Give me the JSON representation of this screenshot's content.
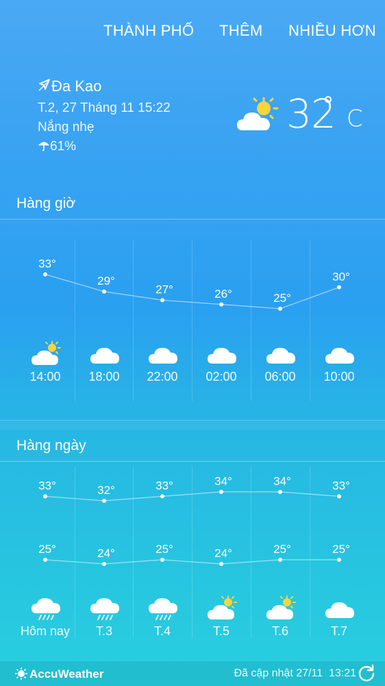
{
  "menu": {
    "city": "THÀNH PHỐ",
    "add": "THÊM",
    "more": "NHIỀU HƠN"
  },
  "current": {
    "location": "Đa Kao",
    "datetime": "T.2, 27 Tháng 11 15:22",
    "condition": "Nắng nhẹ",
    "precip": "61%",
    "temperature": "32",
    "unit": "C",
    "icon": "partly-sunny-icon"
  },
  "hourly": {
    "title": "Hàng giờ",
    "items": [
      {
        "time": "14:00",
        "temp": "33°",
        "value": 33,
        "icon": "partly-sunny-icon"
      },
      {
        "time": "18:00",
        "temp": "29°",
        "value": 29,
        "icon": "cloud-icon"
      },
      {
        "time": "22:00",
        "temp": "27°",
        "value": 27,
        "icon": "cloud-icon"
      },
      {
        "time": "02:00",
        "temp": "26°",
        "value": 26,
        "icon": "cloud-icon"
      },
      {
        "time": "06:00",
        "temp": "25°",
        "value": 25,
        "icon": "cloud-icon"
      },
      {
        "time": "10:00",
        "temp": "30°",
        "value": 30,
        "icon": "cloud-icon"
      }
    ]
  },
  "daily": {
    "title": "Hàng ngày",
    "items": [
      {
        "day": "Hôm nay",
        "high": "33°",
        "high_value": 33,
        "low": "25°",
        "low_value": 25,
        "icon": "cloud-rain-icon"
      },
      {
        "day": "T.3",
        "high": "32°",
        "high_value": 32,
        "low": "24°",
        "low_value": 24,
        "icon": "cloud-rain-icon"
      },
      {
        "day": "T.4",
        "high": "33°",
        "high_value": 33,
        "low": "25°",
        "low_value": 25,
        "icon": "cloud-rain-icon"
      },
      {
        "day": "T.5",
        "high": "34°",
        "high_value": 34,
        "low": "24°",
        "low_value": 24,
        "icon": "partly-sunny-icon"
      },
      {
        "day": "T.6",
        "high": "34°",
        "high_value": 34,
        "low": "25°",
        "low_value": 25,
        "icon": "partly-sunny-icon"
      },
      {
        "day": "T.7",
        "high": "33°",
        "high_value": 33,
        "low": "25°",
        "low_value": 25,
        "icon": "cloud-icon"
      }
    ]
  },
  "footer": {
    "brand": "AccuWeather",
    "updated": "Đã cập nhật 27/11  13:21",
    "refresh_icon": "refresh-icon"
  },
  "colors": {
    "sun": "#fbd43a",
    "cloud": "#ffffff"
  }
}
